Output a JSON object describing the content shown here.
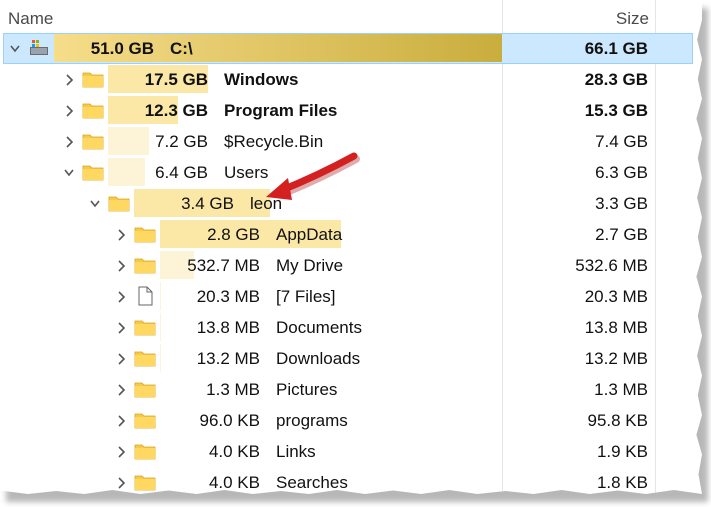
{
  "header": {
    "name_label": "Name",
    "size_label": "Size"
  },
  "colors": {
    "selection": "#cce8ff",
    "bar_strong": "#fbe7a6",
    "bar_light": "#fdf4d8",
    "drive_bar": "#c9ad3d",
    "arrow": "#d32020"
  },
  "rows": [
    {
      "depth": 0,
      "chevron": "chevron-down-icon",
      "icon": "drive-icon",
      "value": "51.0 GB",
      "label": "C:\\",
      "size": "66.1 GB",
      "bold": true,
      "selected": true,
      "bar_fraction": 1.0
    },
    {
      "depth": 1,
      "chevron": "chevron-right-icon",
      "icon": "folder-icon",
      "value": "17.5 GB",
      "label": "Windows",
      "size": "28.3 GB",
      "bold": true,
      "bar_fraction": 0.343
    },
    {
      "depth": 1,
      "chevron": "chevron-right-icon",
      "icon": "folder-icon",
      "value": "12.3 GB",
      "label": "Program Files",
      "size": "15.3 GB",
      "bold": true,
      "bar_fraction": 0.241
    },
    {
      "depth": 1,
      "chevron": "chevron-right-icon",
      "icon": "folder-icon",
      "value": "7.2 GB",
      "label": "$Recycle.Bin",
      "size": "7.4 GB",
      "bold": false,
      "bar_fraction": 0.141
    },
    {
      "depth": 1,
      "chevron": "chevron-down-icon",
      "icon": "folder-icon",
      "value": "6.4 GB",
      "label": "Users",
      "size": "6.3 GB",
      "bold": false,
      "bar_fraction": 0.125
    },
    {
      "depth": 2,
      "chevron": "chevron-down-icon",
      "icon": "folder-icon",
      "value": "3.4 GB",
      "label": "leon",
      "size": "3.3 GB",
      "bold": false,
      "bar_fraction": 0.531
    },
    {
      "depth": 3,
      "chevron": "chevron-right-icon",
      "icon": "folder-icon",
      "value": "2.8 GB",
      "label": "AppData",
      "size": "2.7 GB",
      "bold": false,
      "bar_fraction": 0.824
    },
    {
      "depth": 3,
      "chevron": "chevron-right-icon",
      "icon": "folder-icon",
      "value": "532.7 MB",
      "label": "My Drive",
      "size": "532.6 MB",
      "bold": false,
      "bar_fraction": 0.153
    },
    {
      "depth": 3,
      "chevron": "chevron-right-icon",
      "icon": "file-icon",
      "value": "20.3 MB",
      "label": "[7 Files]",
      "size": "20.3 MB",
      "bold": false,
      "bar_fraction": 0.006
    },
    {
      "depth": 3,
      "chevron": "chevron-right-icon",
      "icon": "folder-icon",
      "value": "13.8 MB",
      "label": "Documents",
      "size": "13.8 MB",
      "bold": false,
      "bar_fraction": 0.004
    },
    {
      "depth": 3,
      "chevron": "chevron-right-icon",
      "icon": "folder-icon",
      "value": "13.2 MB",
      "label": "Downloads",
      "size": "13.2 MB",
      "bold": false,
      "bar_fraction": 0.004
    },
    {
      "depth": 3,
      "chevron": "chevron-right-icon",
      "icon": "folder-icon",
      "value": "1.3 MB",
      "label": "Pictures",
      "size": "1.3 MB",
      "bold": false,
      "bar_fraction": 0.0
    },
    {
      "depth": 3,
      "chevron": "chevron-right-icon",
      "icon": "folder-icon",
      "value": "96.0 KB",
      "label": "programs",
      "size": "95.8 KB",
      "bold": false,
      "bar_fraction": 0.0
    },
    {
      "depth": 3,
      "chevron": "chevron-right-icon",
      "icon": "folder-icon",
      "value": "4.0 KB",
      "label": "Links",
      "size": "1.9 KB",
      "bold": false,
      "bar_fraction": 0.0
    },
    {
      "depth": 3,
      "chevron": "chevron-right-icon",
      "icon": "folder-icon",
      "value": "4.0 KB",
      "label": "Searches",
      "size": "1.8 KB",
      "bold": false,
      "bar_fraction": 0.0
    }
  ]
}
